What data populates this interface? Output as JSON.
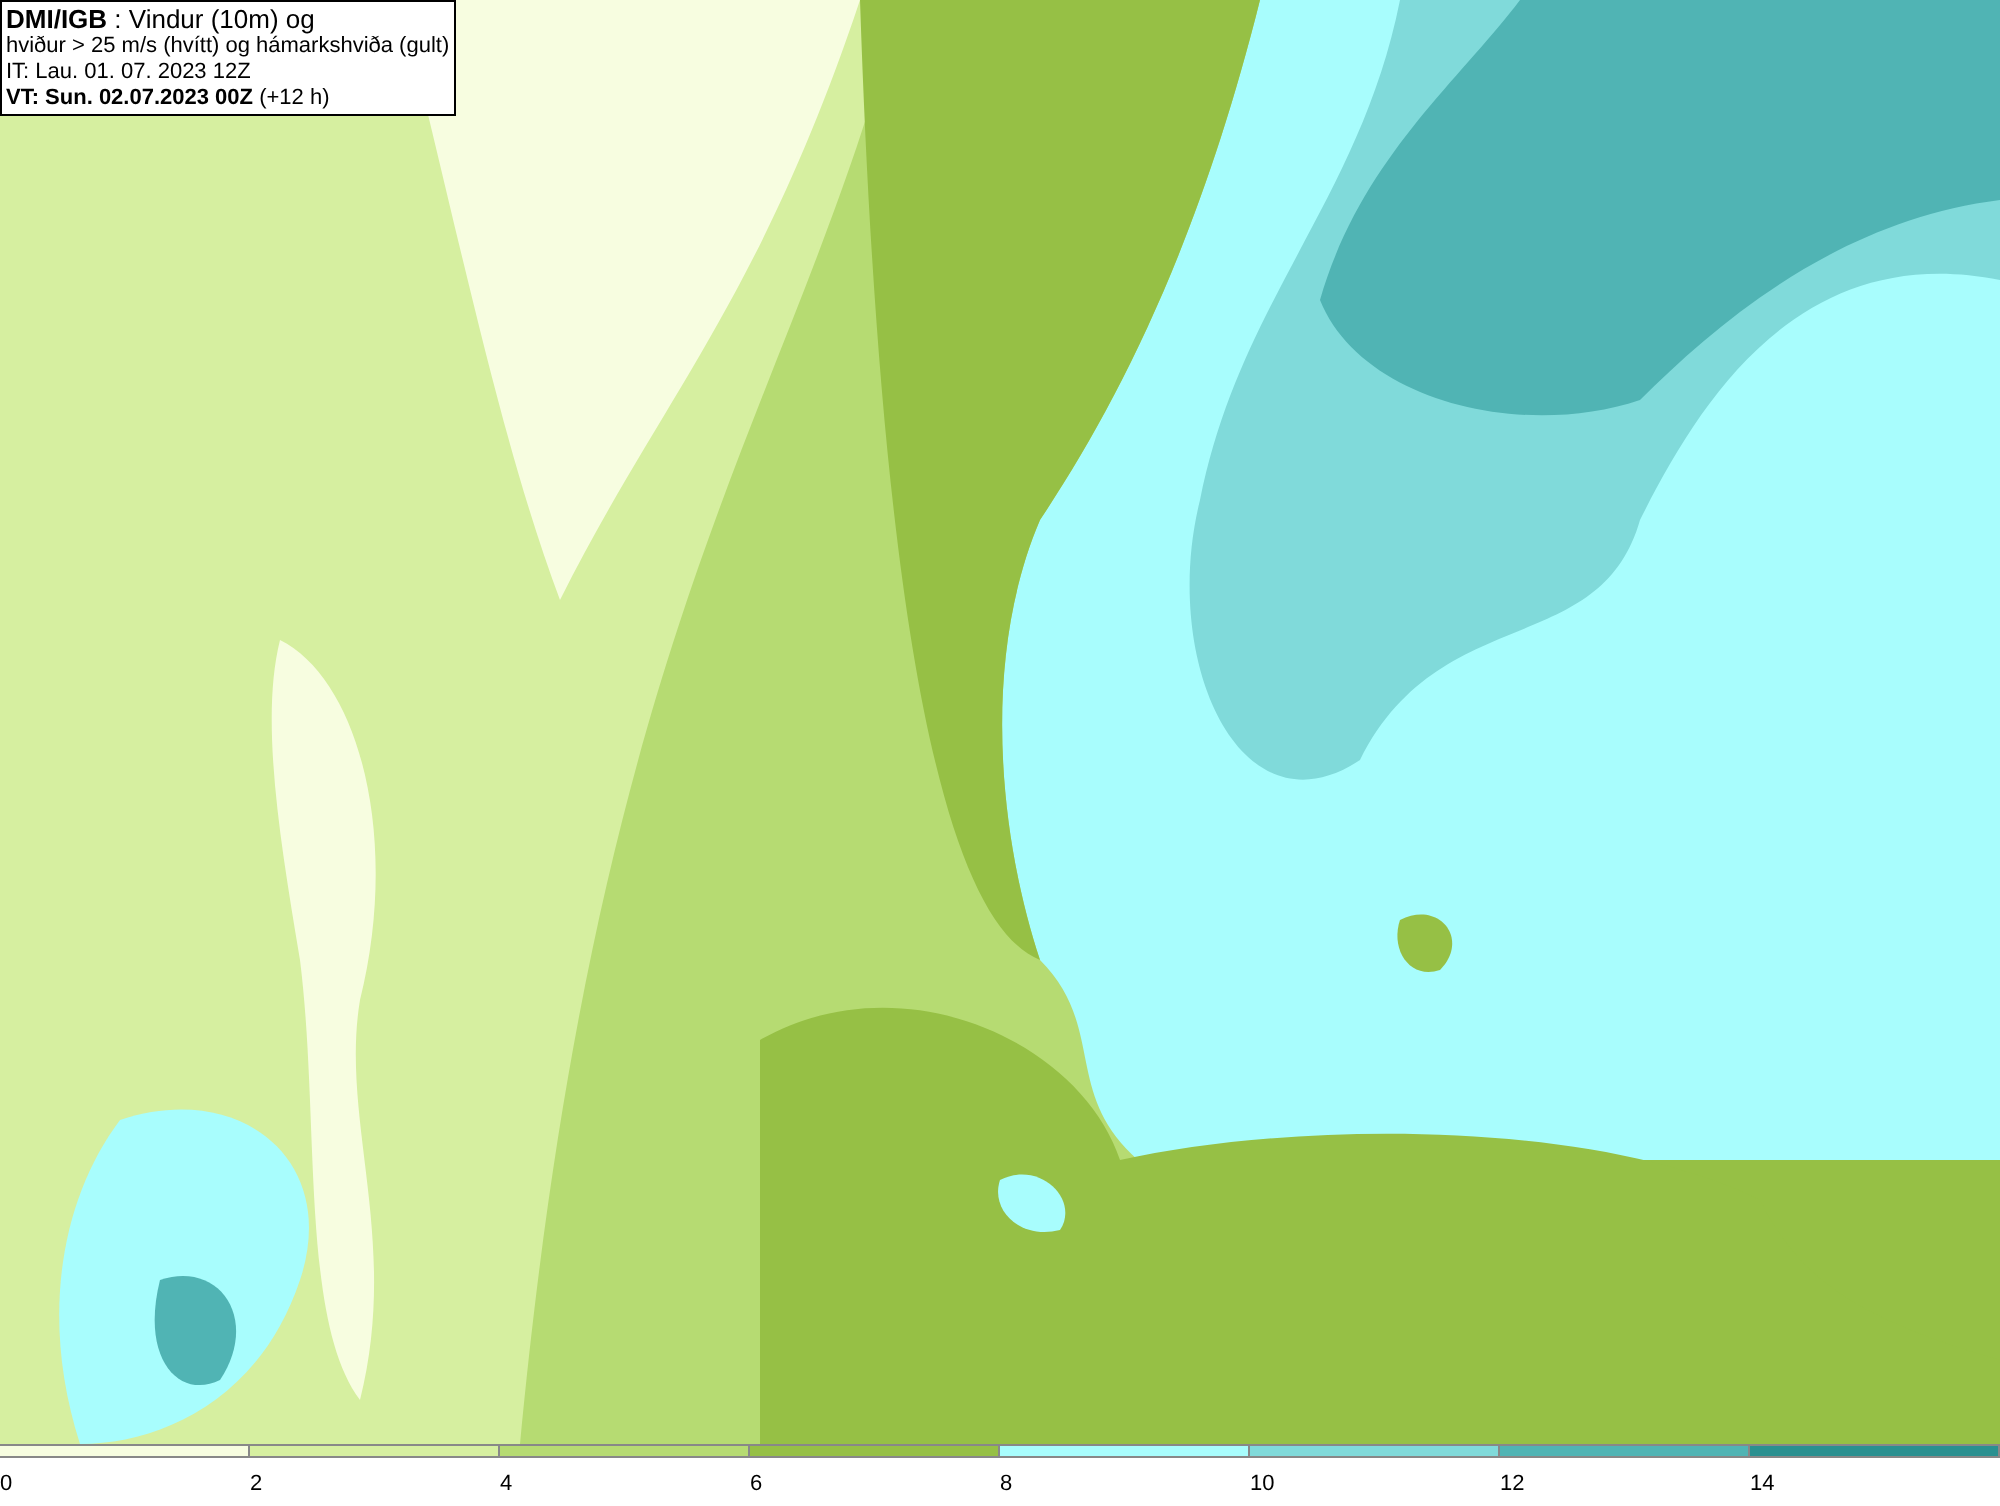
{
  "title_box": {
    "lines": [
      "**DMI/IGB** : Vindur (10m) og",
      "hviður > 25 m/s (hvítt) og hámarkshviða (gult)",
      "IT: Lau. 01. 07. 2023 12Z",
      "**VT: Sun. 02.07.2023 00Z** (+12 h)"
    ]
  },
  "legend": {
    "bins": [
      {
        "color": "#f7fde0"
      },
      {
        "color": "#d6efa0"
      },
      {
        "color": "#b6db72"
      },
      {
        "color": "#96c045"
      },
      {
        "color": "#a8fdfd"
      },
      {
        "color": "#80dada"
      },
      {
        "color": "#50b4b4"
      },
      {
        "color": "#2a9090"
      }
    ],
    "ticks": [
      "0",
      "2",
      "4",
      "6",
      "8",
      "10",
      "12",
      "14"
    ]
  }
}
